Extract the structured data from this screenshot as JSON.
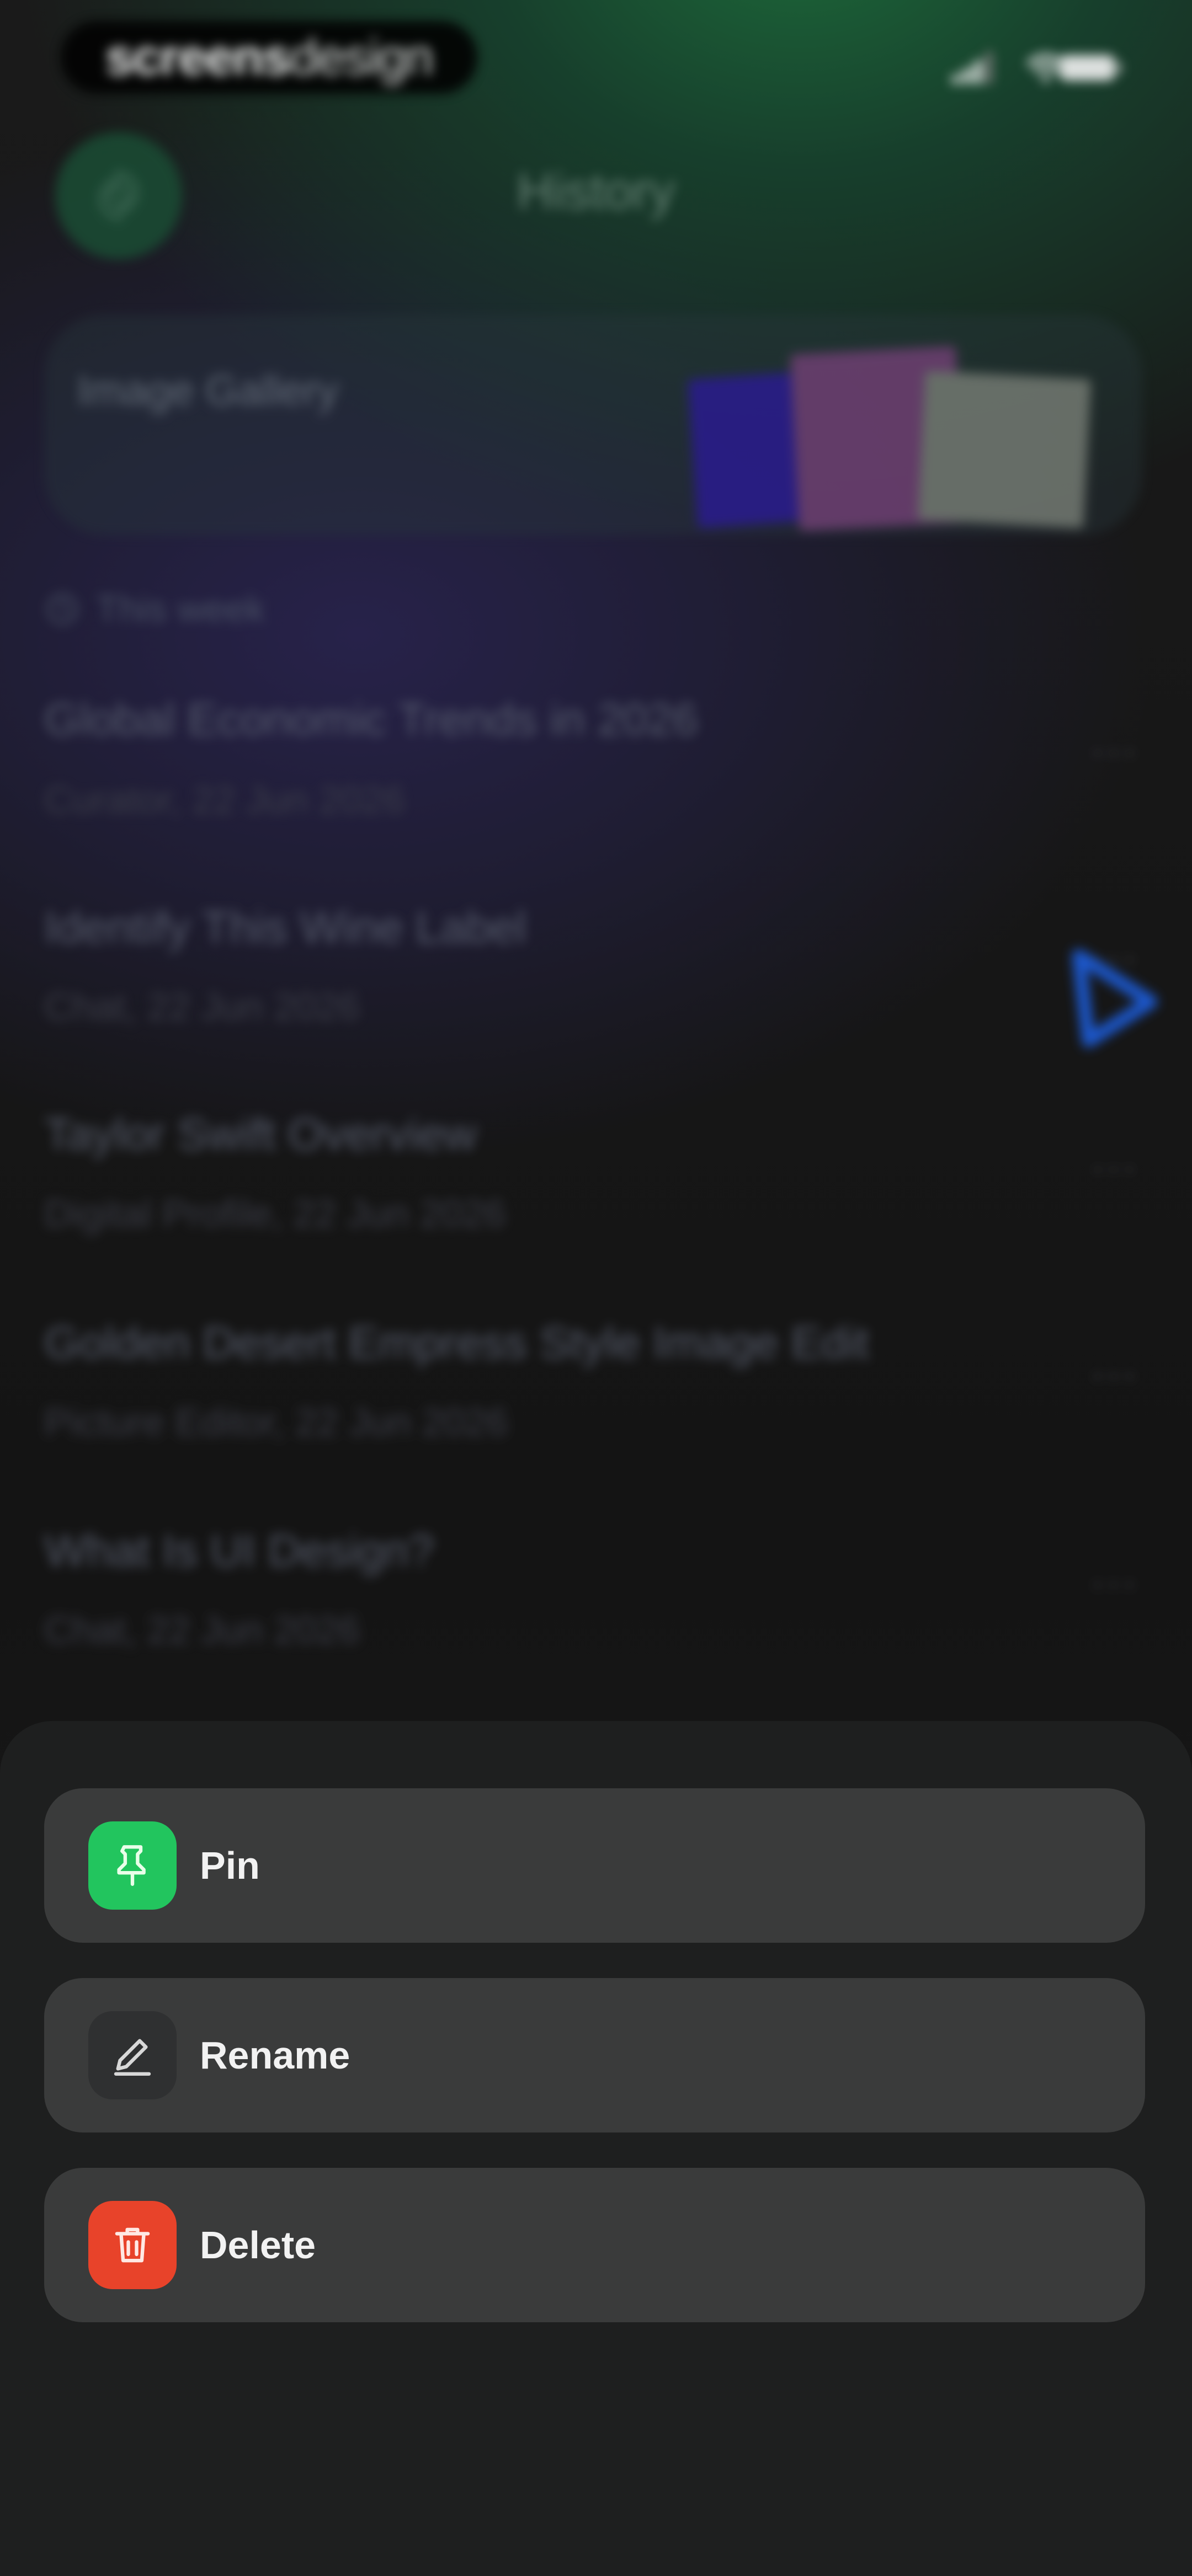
{
  "status_bar": {
    "brand_bold": "screens",
    "brand_light": "design"
  },
  "header": {
    "title": "History"
  },
  "gallery": {
    "label": "Image Gallery",
    "thumb_colors": [
      "#2a1d8a",
      "#6a3f6f",
      "#6f766f"
    ]
  },
  "section": {
    "label": "This week"
  },
  "history_items": [
    {
      "title": "Global Economic Trends in 2026",
      "subtitle": "Curator, 22 Jun 2026"
    },
    {
      "title": "Identify This Wine Label",
      "subtitle": "Chat, 22 Jun 2026"
    },
    {
      "title": "Taylor Swift Overview",
      "subtitle": "Digital Profile, 22 Jun 2026"
    },
    {
      "title": "Golden Desert Empress Style Image Edit",
      "subtitle": "Picture Editor, 22 Jun 2026"
    },
    {
      "title": "What Is UI Design?",
      "subtitle": "Chat, 22 Jun 2026"
    }
  ],
  "more_label": "···",
  "sheet": {
    "actions": [
      {
        "label": "Pin",
        "icon": "pin-icon",
        "color": "#22c55e"
      },
      {
        "label": "Rename",
        "icon": "pencil-icon",
        "color": "#2f3031"
      },
      {
        "label": "Delete",
        "icon": "trash-icon",
        "color": "#e8432a"
      }
    ]
  },
  "colors": {
    "accent_green": "#1d6a3a",
    "cursor_blue": "#1d5fe0"
  }
}
